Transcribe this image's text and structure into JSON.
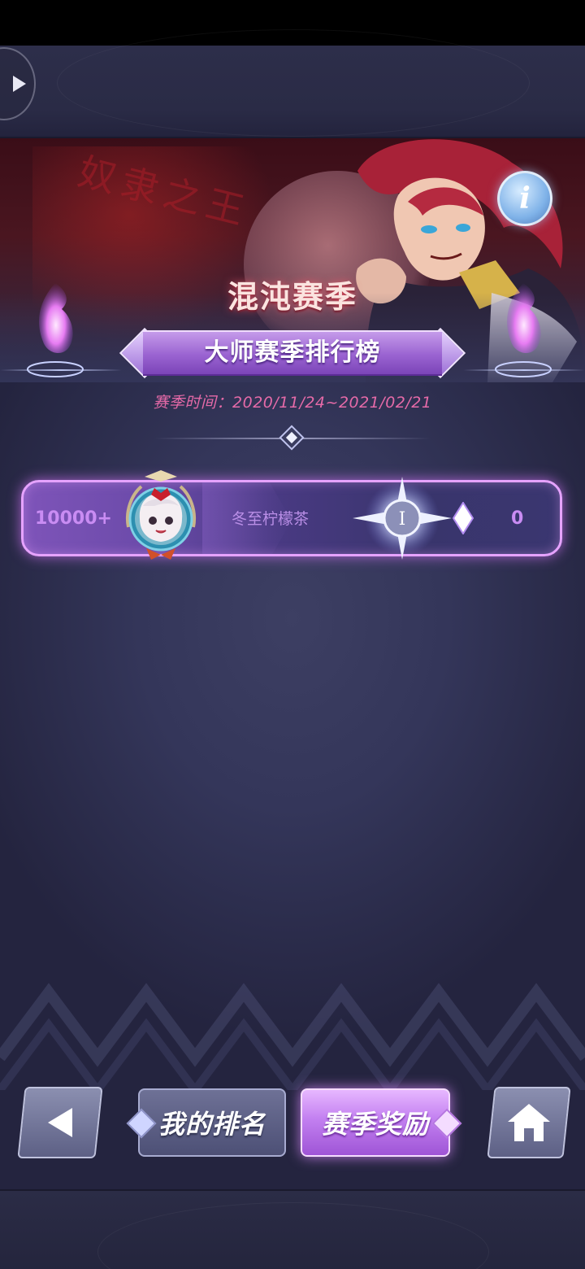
{
  "banner": {
    "season_name": "混沌赛季",
    "leaderboard_title": "大师赛季排行榜",
    "season_time": "赛季时间：2020/11/24~2021/02/21",
    "decorative_text": "奴隶之王"
  },
  "player_row": {
    "rank": "10000+",
    "name": "冬至柠檬茶",
    "score": "0",
    "rank_badge_numeral": "I"
  },
  "buttons": {
    "my_rank": "我的排名",
    "season_reward": "赛季奖励",
    "info": "i"
  },
  "icons": {
    "back": "back-arrow-icon",
    "home": "home-icon",
    "info": "info-icon",
    "currency": "diamond-icon"
  },
  "colors": {
    "accent_purple": "#c27ff0",
    "rank_text": "#c98cf3",
    "season_time_text": "#e56aa8"
  }
}
